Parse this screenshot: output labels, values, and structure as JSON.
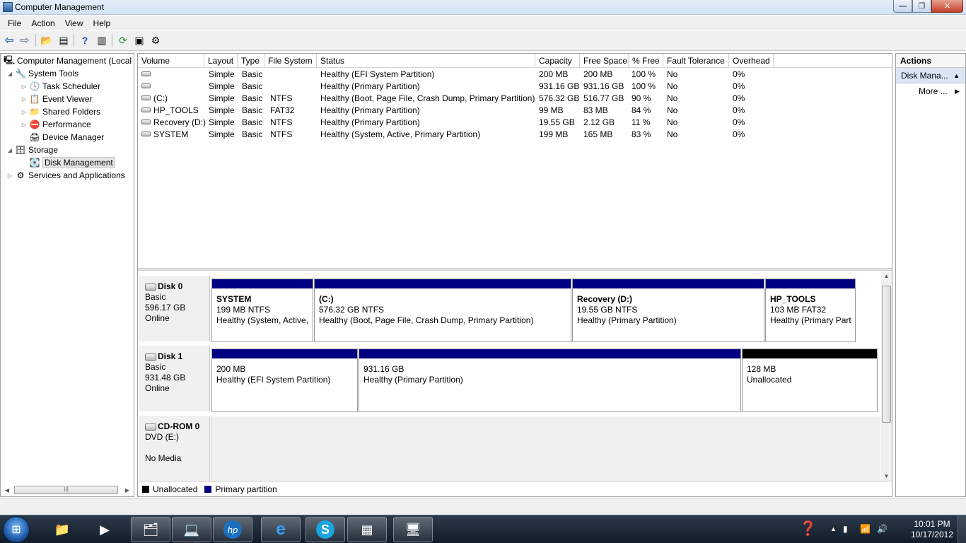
{
  "window": {
    "title": "Computer Management",
    "min": "—",
    "max": "❐",
    "close": "✕"
  },
  "menu": [
    "File",
    "Action",
    "View",
    "Help"
  ],
  "tree": [
    {
      "label": "Computer Management (Local",
      "expander": "",
      "icon": "computer-icon",
      "glyph": "🖳"
    },
    {
      "label": "System Tools",
      "expander": "◢",
      "icon": "tools-icon",
      "glyph": "🔧"
    },
    {
      "label": "Task Scheduler",
      "expander": "▷",
      "icon": "clock-icon",
      "glyph": "🕓"
    },
    {
      "label": "Event Viewer",
      "expander": "▷",
      "icon": "event-viewer-icon",
      "glyph": "📋"
    },
    {
      "label": "Shared Folders",
      "expander": "▷",
      "icon": "shared-folder-icon",
      "glyph": "📁"
    },
    {
      "label": "Performance",
      "expander": "▷",
      "icon": "performance-icon",
      "glyph": "⛔"
    },
    {
      "label": "Device Manager",
      "expander": "",
      "icon": "device-manager-icon",
      "glyph": "🖨"
    },
    {
      "label": "Storage",
      "expander": "◢",
      "icon": "storage-icon",
      "glyph": "🗄"
    },
    {
      "label": "Disk Management",
      "expander": "",
      "icon": "disk-icon",
      "glyph": "💽"
    },
    {
      "label": "Services and Applications",
      "expander": "▷",
      "icon": "services-icon",
      "glyph": "⚙"
    }
  ],
  "tree_scroll_thumb": "III",
  "volume_table": {
    "headers": [
      "Volume",
      "Layout",
      "Type",
      "File System",
      "Status",
      "Capacity",
      "Free Space",
      "% Free",
      "Fault Tolerance",
      "Overhead"
    ],
    "rows": [
      [
        "",
        "Simple",
        "Basic",
        "",
        "Healthy (EFI System Partition)",
        "200 MB",
        "200 MB",
        "100 %",
        "No",
        "0%"
      ],
      [
        "",
        "Simple",
        "Basic",
        "",
        "Healthy (Primary Partition)",
        "931.16 GB",
        "931.16 GB",
        "100 %",
        "No",
        "0%"
      ],
      [
        "(C:)",
        "Simple",
        "Basic",
        "NTFS",
        "Healthy (Boot, Page File, Crash Dump, Primary Partition)",
        "576.32 GB",
        "516.77 GB",
        "90 %",
        "No",
        "0%"
      ],
      [
        "HP_TOOLS",
        "Simple",
        "Basic",
        "FAT32",
        "Healthy (Primary Partition)",
        "99 MB",
        "83 MB",
        "84 %",
        "No",
        "0%"
      ],
      [
        "Recovery (D:)",
        "Simple",
        "Basic",
        "NTFS",
        "Healthy (Primary Partition)",
        "19.55 GB",
        "2.12 GB",
        "11 %",
        "No",
        "0%"
      ],
      [
        "SYSTEM",
        "Simple",
        "Basic",
        "NTFS",
        "Healthy (System, Active, Primary Partition)",
        "199 MB",
        "165 MB",
        "83 %",
        "No",
        "0%"
      ]
    ]
  },
  "disks": [
    {
      "name": "Disk 0",
      "type": "Basic",
      "size": "596.17 GB",
      "status": "Online",
      "partitions": [
        {
          "name": "SYSTEM",
          "size": "199 MB NTFS",
          "status": "Healthy (System, Active,",
          "kind": "primary"
        },
        {
          "name": " (C:)",
          "size": "576.32 GB NTFS",
          "status": "Healthy (Boot, Page File, Crash Dump, Primary Partition)",
          "kind": "primary"
        },
        {
          "name": "Recovery  (D:)",
          "size": "19.55 GB NTFS",
          "status": "Healthy (Primary Partition)",
          "kind": "primary"
        },
        {
          "name": "HP_TOOLS",
          "size": "103 MB FAT32",
          "status": "Healthy (Primary Part",
          "kind": "primary"
        }
      ]
    },
    {
      "name": "Disk 1",
      "type": "Basic",
      "size": "931.48 GB",
      "status": "Online",
      "partitions": [
        {
          "name": "",
          "size": "200 MB",
          "status": "Healthy (EFI System Partition)",
          "kind": "primary"
        },
        {
          "name": "",
          "size": "931.16 GB",
          "status": "Healthy (Primary Partition)",
          "kind": "primary"
        },
        {
          "name": "",
          "size": "128 MB",
          "status": "Unallocated",
          "kind": "unallocated"
        }
      ]
    }
  ],
  "cdrom": {
    "name": "CD-ROM 0",
    "drive": "DVD (E:)",
    "status": "No Media"
  },
  "legend": [
    {
      "label": "Unallocated",
      "color": "#000000"
    },
    {
      "label": "Primary partition",
      "color": "#000080"
    }
  ],
  "actions": {
    "header": "Actions",
    "section": "Disk Mana...",
    "more": "More ..."
  },
  "taskbar": {
    "apps": [
      {
        "name": "explorer",
        "icon": "folder-icon",
        "glyph": "📁",
        "open": false
      },
      {
        "name": "media-player",
        "icon": "media-player-icon",
        "glyph": "▶",
        "open": false
      },
      {
        "name": "app-3",
        "icon": "app-icon",
        "glyph": "🗂",
        "open": true
      },
      {
        "name": "app-4",
        "icon": "app-icon",
        "glyph": "💻",
        "open": true
      },
      {
        "name": "hp",
        "icon": "hp-icon",
        "glyph": "hp",
        "open": true
      },
      {
        "name": "internet-explorer",
        "icon": "ie-icon",
        "glyph": "e",
        "open": true
      },
      {
        "name": "skype",
        "icon": "skype-icon",
        "glyph": "S",
        "open": true
      },
      {
        "name": "app-8",
        "icon": "app-icon",
        "glyph": "▦",
        "open": true
      },
      {
        "name": "computer-management",
        "icon": "computer-management-icon",
        "glyph": "🖥",
        "open": true
      }
    ],
    "time": "10:01 PM",
    "date": "10/17/2012"
  },
  "colors": {
    "primary_partition": "#000080",
    "unallocated": "#000000",
    "taskbar": "#1c2733"
  }
}
